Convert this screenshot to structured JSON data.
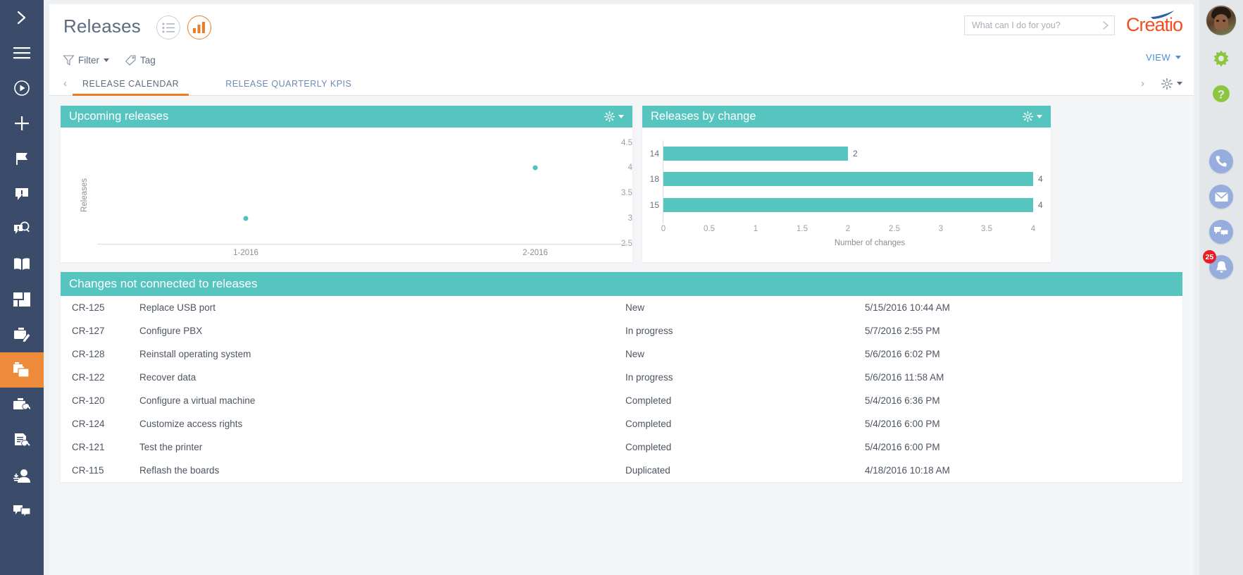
{
  "header": {
    "title": "Releases",
    "toggles": [
      {
        "name": "list-view-toggle",
        "icon": "list-icon",
        "selected": false
      },
      {
        "name": "chart-view-toggle",
        "icon": "bar-chart-icon",
        "selected": true
      }
    ],
    "search": {
      "placeholder": "What can I do for you?",
      "value": ""
    },
    "logo_text": "Creatio",
    "view_menu_label": "VIEW"
  },
  "filterbar": {
    "filter_label": "Filter",
    "tag_label": "Tag"
  },
  "tabs": {
    "items": [
      {
        "label": "RELEASE CALENDAR",
        "active": true
      },
      {
        "label": "RELEASE QUARTERLY KPIS",
        "active": false
      }
    ],
    "prev_arrow": "‹",
    "next_arrow": "›"
  },
  "widgets": {
    "upcoming": {
      "title": "Upcoming releases"
    },
    "by_change": {
      "title": "Releases by change"
    },
    "changes_table": {
      "title": "Changes not connected to releases"
    }
  },
  "chart_data": [
    {
      "type": "scatter",
      "title": "Upcoming releases",
      "x": [
        "1-2016",
        "2-2016"
      ],
      "values": [
        3,
        4
      ],
      "xlabel": "",
      "ylabel": "Releases",
      "ylim": [
        2.5,
        4.5
      ],
      "yticks": [
        "2.5",
        "3",
        "3.5",
        "4",
        "4.5"
      ],
      "ytick_values": [
        2.5,
        3,
        3.5,
        4,
        4.5
      ],
      "grid": false,
      "legend": "none",
      "point_color": "#4ec3bd"
    },
    {
      "type": "bar",
      "title": "Releases by change",
      "orientation": "horizontal",
      "categories": [
        "14",
        "18",
        "15"
      ],
      "values": [
        2,
        4,
        4
      ],
      "data_labels": [
        "2",
        "4",
        "4"
      ],
      "xlabel": "Number of changes",
      "ylabel": "",
      "xlim": [
        0,
        4
      ],
      "xticks": [
        "0",
        "0.5",
        "1",
        "1.5",
        "2",
        "2.5",
        "3",
        "3.5",
        "4"
      ],
      "xtick_values": [
        0,
        0.5,
        1,
        1.5,
        2,
        2.5,
        3,
        3.5,
        4
      ],
      "grid": false,
      "legend": "none",
      "bar_color": "#56c5c0"
    }
  ],
  "changes_table": {
    "rows": [
      {
        "code": "CR-125",
        "title": "Replace USB port",
        "status": "New",
        "date": "5/15/2016 10:44 AM"
      },
      {
        "code": "CR-127",
        "title": "Configure PBX",
        "status": "In progress",
        "date": "5/7/2016 2:55 PM"
      },
      {
        "code": "CR-128",
        "title": "Reinstall operating system",
        "status": "New",
        "date": "5/6/2016 6:02 PM"
      },
      {
        "code": "CR-122",
        "title": "Recover data",
        "status": "In progress",
        "date": "5/6/2016 11:58 AM"
      },
      {
        "code": "CR-120",
        "title": "Configure a virtual machine",
        "status": "Completed",
        "date": "5/4/2016 6:36 PM"
      },
      {
        "code": "CR-124",
        "title": "Customize access rights",
        "status": "Completed",
        "date": "5/4/2016 6:00 PM"
      },
      {
        "code": "CR-121",
        "title": "Test the printer",
        "status": "Completed",
        "date": "5/4/2016 6:00 PM"
      },
      {
        "code": "CR-115",
        "title": "Reflash the boards",
        "status": "Duplicated",
        "date": "4/18/2016 10:18 AM"
      }
    ]
  },
  "left_rail": {
    "items": [
      {
        "icon": "chevron-right-icon",
        "active": false
      },
      {
        "icon": "hamburger-menu-icon",
        "active": false
      },
      {
        "icon": "play-circle-icon",
        "active": false
      },
      {
        "icon": "plus-icon",
        "active": false
      },
      {
        "icon": "flag-icon",
        "active": false
      },
      {
        "icon": "alert-bubble-icon",
        "active": false
      },
      {
        "icon": "search-bubble-icon",
        "active": false
      },
      {
        "icon": "knowledge-book-icon",
        "active": false
      },
      {
        "icon": "dashboard-grid-icon",
        "active": false
      },
      {
        "icon": "case-pencil-icon",
        "active": false
      },
      {
        "icon": "folders-icon",
        "active": true
      },
      {
        "icon": "case-wrench-icon",
        "active": false
      },
      {
        "icon": "document-wrench-icon",
        "active": false
      },
      {
        "icon": "agent-headset-icon",
        "active": false
      },
      {
        "icon": "chat-bubbles-icon",
        "active": false
      }
    ]
  },
  "right_rail": {
    "avatar": "user-avatar",
    "gear": "settings-gear-icon",
    "help": "help-question-icon",
    "comm": [
      {
        "icon": "phone-icon",
        "badge": ""
      },
      {
        "icon": "mail-icon",
        "badge": ""
      },
      {
        "icon": "chat-icon",
        "badge": ""
      },
      {
        "icon": "bell-icon",
        "badge": "25"
      }
    ]
  },
  "colors": {
    "accent_teal": "#56c5c0",
    "accent_orange": "#ee7d22",
    "rail_blue": "#3b4c6b",
    "link_blue": "#4b8fd4",
    "badge_red": "#ea1c24"
  }
}
